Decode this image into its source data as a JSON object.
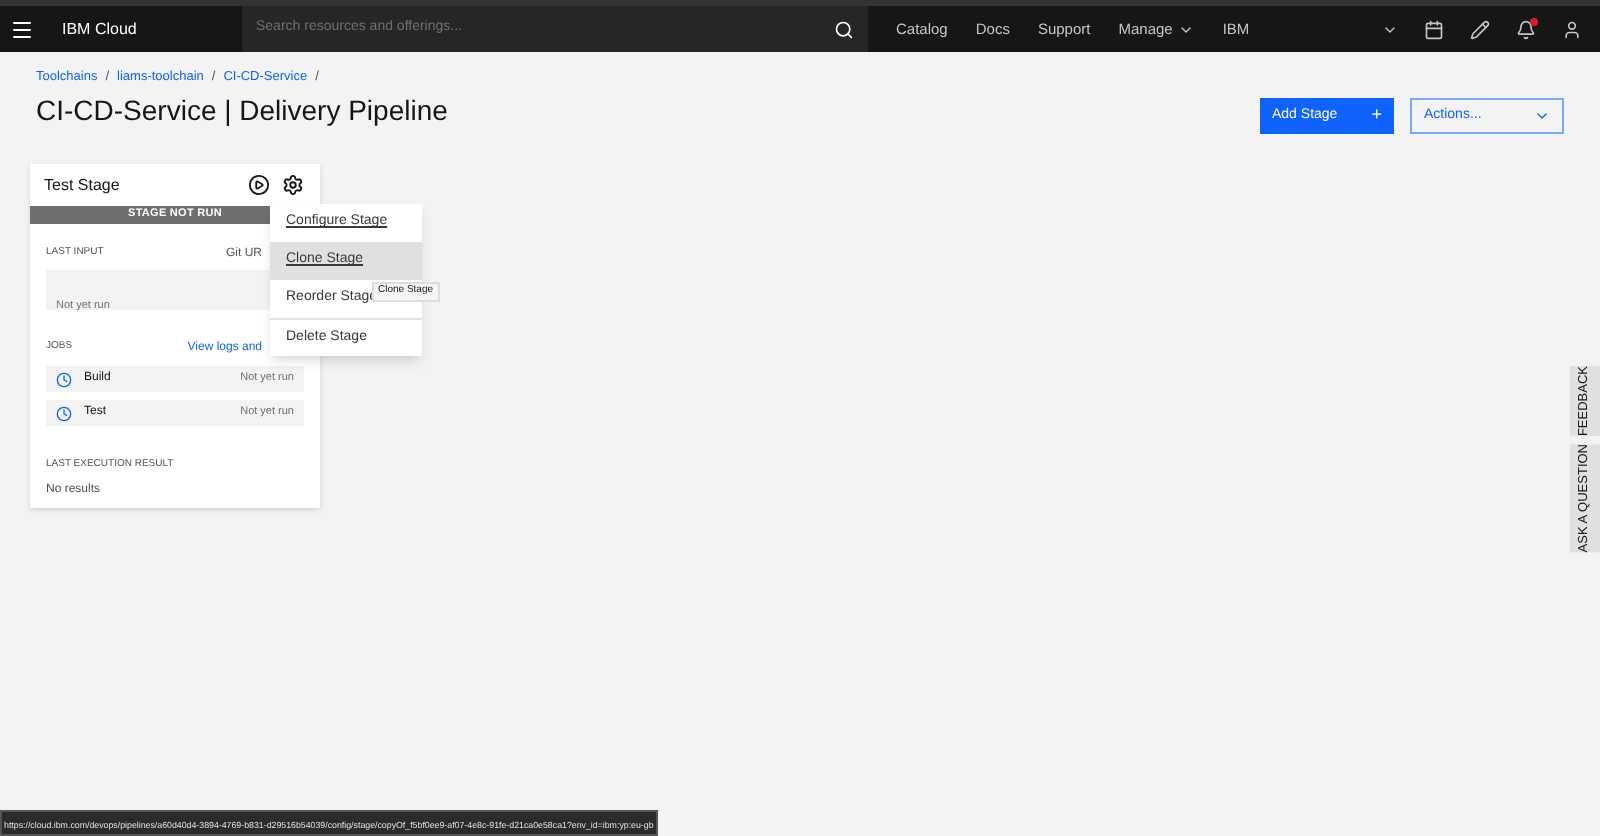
{
  "header": {
    "brand": "IBM Cloud",
    "search": {
      "placeholder": "Search resources and offerings..."
    },
    "nav": [
      {
        "label": "Catalog",
        "kind": "link"
      },
      {
        "label": "Docs",
        "kind": "link"
      },
      {
        "label": "Support",
        "kind": "link"
      },
      {
        "label": "Manage",
        "kind": "dropdown"
      },
      {
        "label": "IBM",
        "kind": "link"
      }
    ],
    "notification": true
  },
  "breadcrumbs": [
    {
      "label": "Toolchains",
      "separator": "/"
    },
    {
      "label": "liams-toolchain",
      "separator": "/"
    },
    {
      "label": "CI-CD-Service",
      "separator": "/"
    }
  ],
  "title": "CI-CD-Service | Delivery Pipeline",
  "actions": {
    "add_stage": "Add Stage",
    "add_icon": "+",
    "dropdown": "Actions..."
  },
  "stage": {
    "name": "Test Stage",
    "status": "STAGE NOT RUN",
    "last_input_label": "LAST INPUT",
    "input_type": "Git UR",
    "input_value": "Not yet run",
    "jobs_label": "JOBS",
    "view_logs": "View logs and",
    "jobs": [
      {
        "name": "Build",
        "status": "Not yet run"
      },
      {
        "name": "Test",
        "status": "Not yet run"
      }
    ],
    "result_label": "LAST EXECUTION RESULT",
    "result_value": "No results"
  },
  "menu": {
    "items": [
      {
        "label": "Configure Stage",
        "kind": "link",
        "selected": false
      },
      {
        "label": "Clone Stage",
        "kind": "link",
        "selected": true
      },
      {
        "label": "Reorder Stage",
        "kind": "plain",
        "selected": false
      },
      {
        "label": "Delete Stage",
        "kind": "plain",
        "selected": false
      }
    ],
    "tooltip": "Clone Stage"
  },
  "side_tabs": [
    "FEEDBACK",
    "ASK A QUESTION"
  ],
  "status_url": "https://cloud.ibm.com/devops/pipelines/a60d40d4-3894-4769-b831-d29516b54039/config/stage/copyOf_f5bf0ee9-af07-4e8c-91fe-d21ca0e58ca1?env_id=ibm:yp:eu-gb"
}
